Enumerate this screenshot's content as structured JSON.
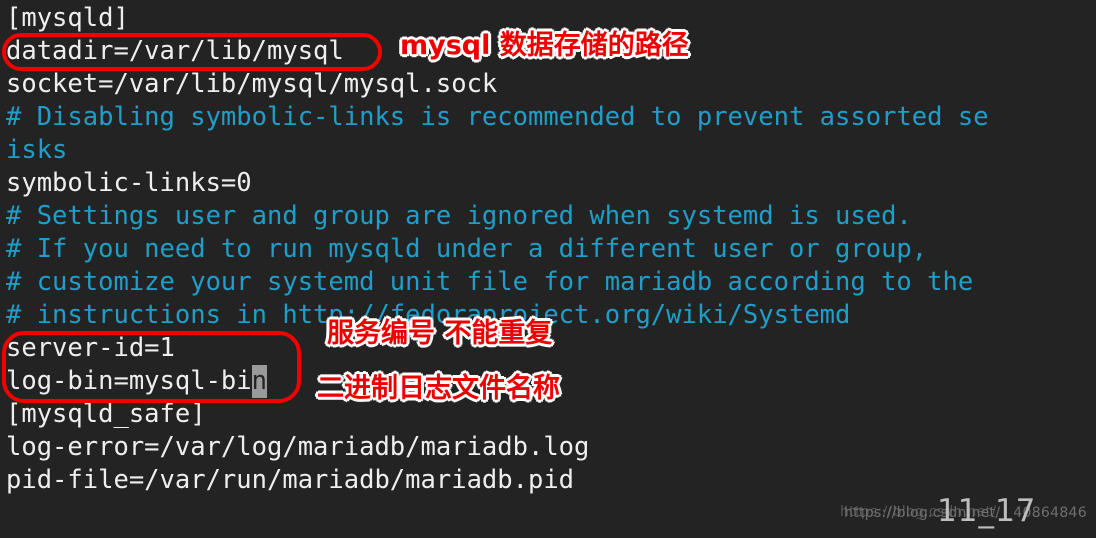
{
  "terminal": {
    "background_color": "#232323",
    "text_color": "#e6e6e6",
    "comment_color": "#1f9ec9",
    "lines": [
      {
        "text": "[mysqld]",
        "type": "section"
      },
      {
        "text": "datadir=/var/lib/mysql",
        "type": "plain"
      },
      {
        "text": "socket=/var/lib/mysql/mysql.sock",
        "type": "plain"
      },
      {
        "text": "# Disabling symbolic-links is recommended to prevent assorted se",
        "type": "comment"
      },
      {
        "text": "isks",
        "type": "comment"
      },
      {
        "text": "symbolic-links=0",
        "type": "plain"
      },
      {
        "text": "# Settings user and group are ignored when systemd is used.",
        "type": "comment"
      },
      {
        "text": "# If you need to run mysqld under a different user or group,",
        "type": "comment"
      },
      {
        "text": "# customize your systemd unit file for mariadb according to the",
        "type": "comment"
      },
      {
        "text": "# instructions in http://fedoraproject.org/wiki/Systemd",
        "type": "comment"
      },
      {
        "text": "server-id=1",
        "type": "plain"
      },
      {
        "text": "log-bin=mysql-bi",
        "type": "plain",
        "cursor": "n"
      },
      {
        "text": "[mysqld_safe]",
        "type": "section"
      },
      {
        "text": "log-error=/var/log/mariadb/mariadb.log",
        "type": "plain"
      },
      {
        "text": "pid-file=/var/run/mariadb/mariadb.pid",
        "type": "plain"
      }
    ]
  },
  "annotations": {
    "box_color": "#f40000",
    "text_color": "#ef0000",
    "items": [
      {
        "label": "mysql 数据存储的路径"
      },
      {
        "label": "服务编号 不能重复"
      },
      {
        "label": "二进制日志文件名称"
      }
    ],
    "highlight_boxes": [
      {
        "name": "datadir-highlight-box"
      },
      {
        "name": "replication-settings-highlight-box"
      }
    ]
  },
  "watermark": {
    "url": "https://blog.csdn.net/",
    "url_ghost": "https://blog.csdn.net/",
    "suffix": "_40864846",
    "overlay": "11_17"
  }
}
